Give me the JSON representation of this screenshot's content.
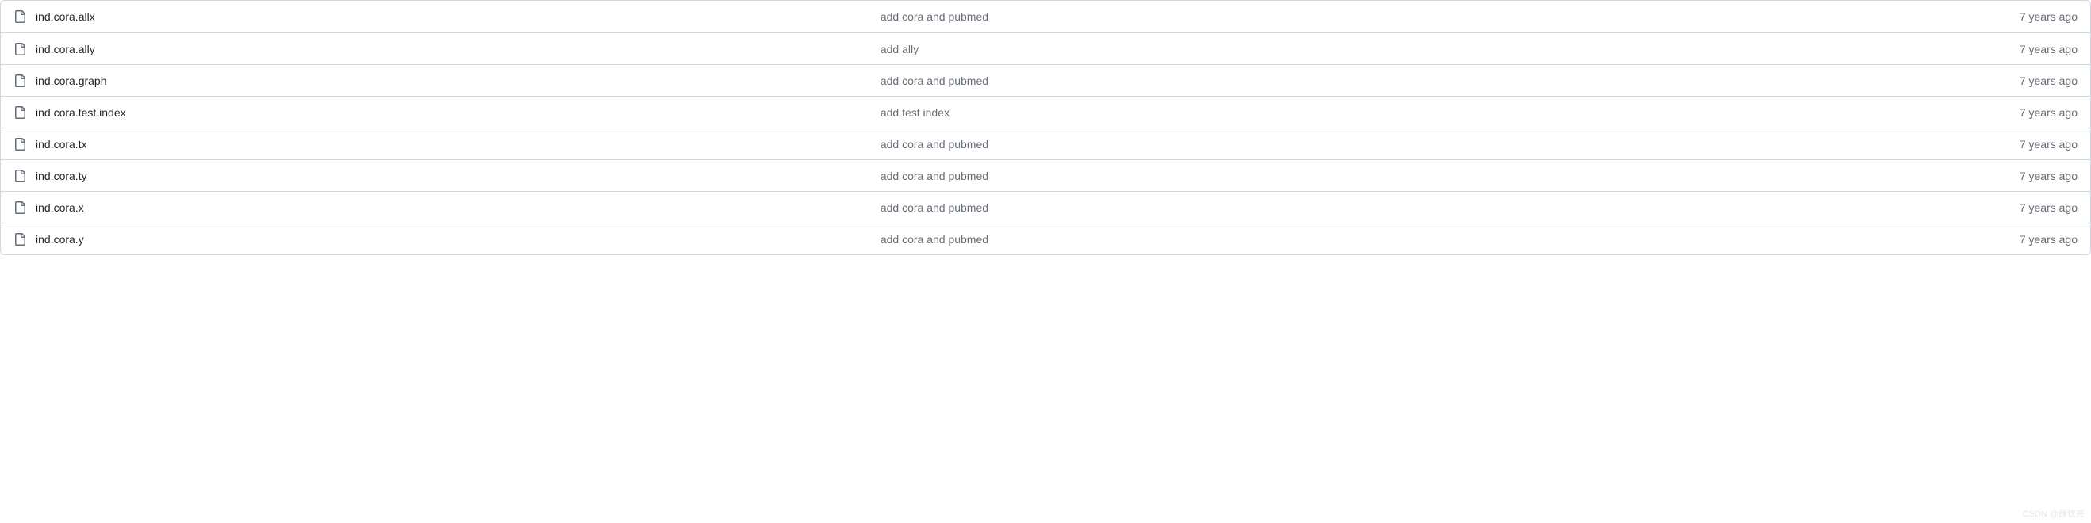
{
  "files": [
    {
      "name": "ind.cora.allx",
      "commit_message": "add cora and pubmed",
      "age": "7 years ago"
    },
    {
      "name": "ind.cora.ally",
      "commit_message": "add ally",
      "age": "7 years ago"
    },
    {
      "name": "ind.cora.graph",
      "commit_message": "add cora and pubmed",
      "age": "7 years ago"
    },
    {
      "name": "ind.cora.test.index",
      "commit_message": "add test index",
      "age": "7 years ago"
    },
    {
      "name": "ind.cora.tx",
      "commit_message": "add cora and pubmed",
      "age": "7 years ago"
    },
    {
      "name": "ind.cora.ty",
      "commit_message": "add cora and pubmed",
      "age": "7 years ago"
    },
    {
      "name": "ind.cora.x",
      "commit_message": "add cora and pubmed",
      "age": "7 years ago"
    },
    {
      "name": "ind.cora.y",
      "commit_message": "add cora and pubmed",
      "age": "7 years ago"
    }
  ],
  "watermark": "CSDN @薛钦亮"
}
